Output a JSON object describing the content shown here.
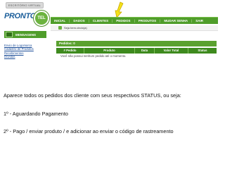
{
  "logo": {
    "tag": "ESCRITÓRIO VIRTUAL",
    "name": "PRONTO",
    "badge": "TEL"
  },
  "topnav": {
    "items": [
      "INICIAL",
      "DADOS",
      "CLIENTES",
      "PEDIDOS",
      "PRODUTOS",
      "MUDAR SENHA",
      "SAIR"
    ]
  },
  "welcome": {
    "text": "Seja bem-vindo(a)"
  },
  "sidebar": {
    "header": "MENSAGENS",
    "links": [
      "Envio de Logomarca",
      "Cadastro de Produtos",
      "Recebimentos",
      "Dúvidas"
    ]
  },
  "orders": {
    "title": "Pedidos: 0",
    "columns": [
      "# Pedido",
      "Produto",
      "Data",
      "Valor Total",
      "Status"
    ],
    "empty_message": "Você não possui nenhum pedido até o momento."
  },
  "description": {
    "line1": "Aparece todos os pedidos dos cliente com seus respectivos STATUS, ou seja:",
    "line2": "1º - Aguardando Pagamento",
    "line3": "2º - Pago / enviar produto / e adicionar ao enviar o código de rastreamento"
  },
  "colors": {
    "nav_green": "#4f9d2a",
    "header_green": "#3e8a1e",
    "logo_blue": "#1b5e9a",
    "arrow_yellow": "#f4e21a"
  }
}
